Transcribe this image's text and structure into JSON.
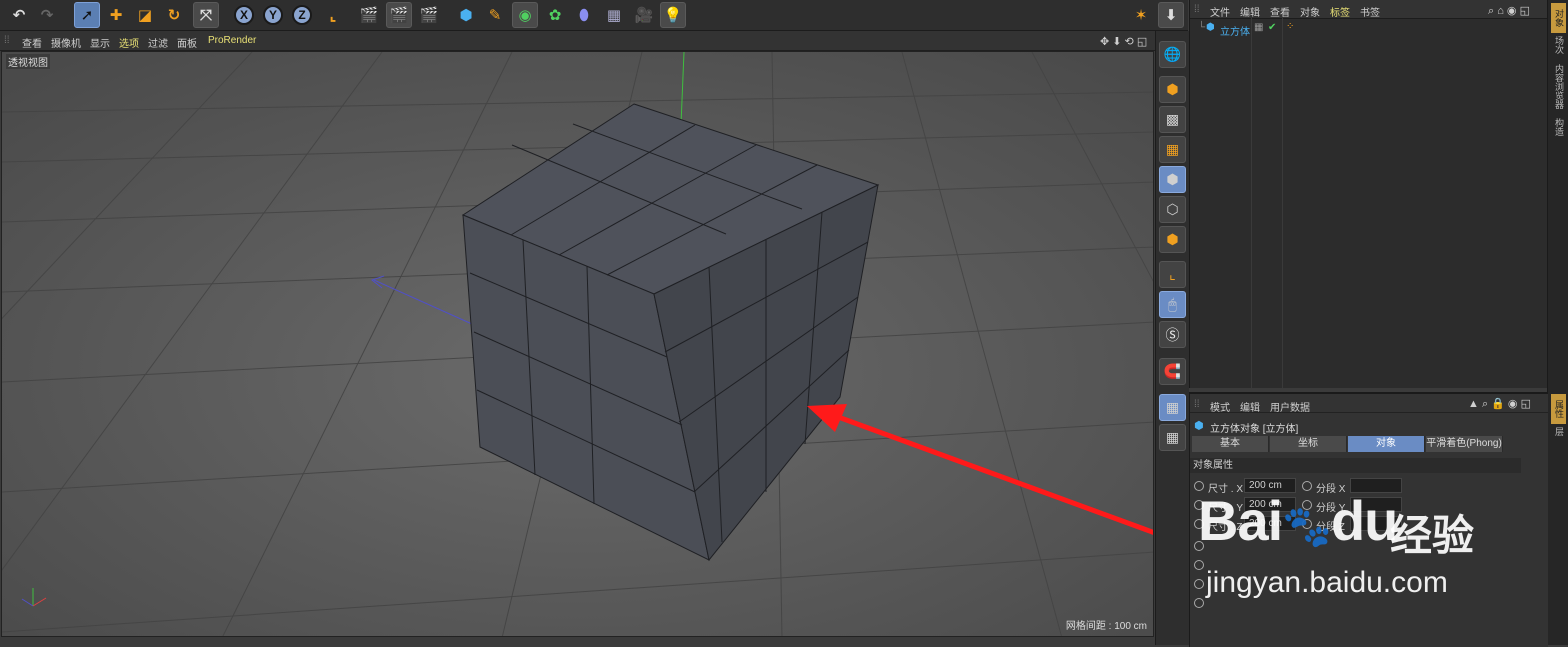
{
  "toolbar": {
    "undo_icon": "undo-icon",
    "redo_icon": "redo-icon",
    "axes": [
      "X",
      "Y",
      "Z"
    ],
    "colors": {
      "accent": "#e8e075",
      "selected": "#6a8cc4",
      "cube": "#4b4e56"
    }
  },
  "viewport_menu": {
    "items": [
      "查看",
      "摄像机",
      "显示",
      "选项",
      "过滤",
      "面板"
    ],
    "active_index": 3,
    "prorender": "ProRender"
  },
  "viewport": {
    "label": "透视视图",
    "grid_scale": "网格间距 : 100 cm"
  },
  "object_manager": {
    "menu": [
      "文件",
      "编辑",
      "查看",
      "对象",
      "标签",
      "书签"
    ],
    "active_index": 4,
    "object_name": "立方体"
  },
  "side_tabs": [
    "对象",
    "场次",
    "内容浏览器",
    "构造"
  ],
  "attr_side_tabs": [
    "属性",
    "层"
  ],
  "attribute_manager": {
    "menu": [
      "模式",
      "编辑",
      "用户数据"
    ],
    "title": "立方体对象 [立方体]",
    "tabs": [
      "基本",
      "坐标",
      "对象",
      "平滑着色(Phong)"
    ],
    "active_tab": 2,
    "section": "对象属性",
    "props": [
      {
        "label": "尺寸 . X",
        "value": "200 cm",
        "label2": "分段 X"
      },
      {
        "label": "尺寸 . Y",
        "value": "200 cm",
        "label2": "分段 Y"
      },
      {
        "label": "尺寸 . Z",
        "value": "200 cm",
        "label2": "分段 Z"
      }
    ]
  },
  "watermark": {
    "brand": "Bai",
    "brand2": "du",
    "cn": "经验",
    "url": "jingyan.baidu.com"
  }
}
